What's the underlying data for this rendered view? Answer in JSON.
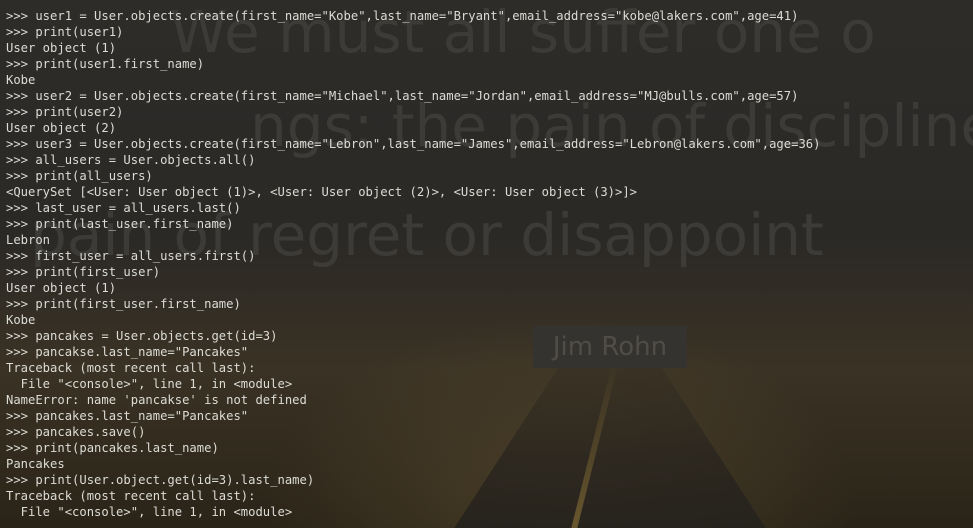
{
  "wallpaper": {
    "quote_lines": [
      "We must all suffer one o",
      "ngs: the pain of discipline",
      "pain of regret or disappoint"
    ],
    "author": "Jim Rohn"
  },
  "terminal": {
    "lines": [
      ">>> user1 = User.objects.create(first_name=\"Kobe\",last_name=\"Bryant\",email_address=\"kobe@lakers.com\",age=41)",
      ">>> print(user1)",
      "User object (1)",
      ">>> print(user1.first_name)",
      "Kobe",
      ">>> user2 = User.objects.create(first_name=\"Michael\",last_name=\"Jordan\",email_address=\"MJ@bulls.com\",age=57)",
      ">>> print(user2)",
      "User object (2)",
      ">>> user3 = User.objects.create(first_name=\"Lebron\",last_name=\"James\",email_address=\"Lebron@lakers.com\",age=36)",
      ">>> all_users = User.objects.all()",
      ">>> print(all_users)",
      "<QuerySet [<User: User object (1)>, <User: User object (2)>, <User: User object (3)>]>",
      ">>> last_user = all_users.last()",
      ">>> print(last_user.first_name)",
      "Lebron",
      ">>> first_user = all_users.first()",
      ">>> print(first_user)",
      "User object (1)",
      ">>> print(first_user.first_name)",
      "Kobe",
      ">>> pancakes = User.objects.get(id=3)",
      ">>> pancakse.last_name=\"Pancakes\"",
      "Traceback (most recent call last):",
      "  File \"<console>\", line 1, in <module>",
      "NameError: name 'pancakse' is not defined",
      ">>> pancakes.last_name=\"Pancakes\"",
      ">>> pancakes.save()",
      ">>> print(pancakes.last_name)",
      "Pancakes",
      ">>> print(User.object.get(id=3).last_name)",
      "Traceback (most recent call last):",
      "  File \"<console>\", line 1, in <module>"
    ]
  }
}
